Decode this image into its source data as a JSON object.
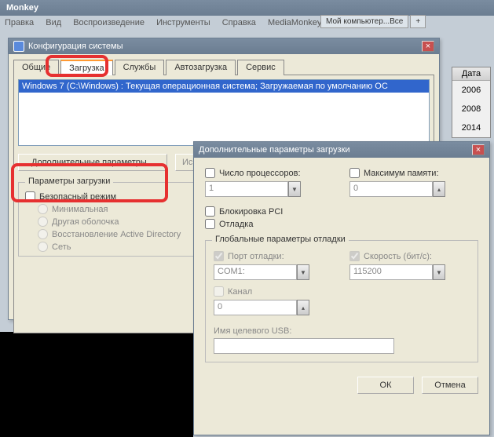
{
  "app": {
    "title": "Monkey",
    "menu": [
      "Правка",
      "Вид",
      "Воспроизведение",
      "Инструменты",
      "Справка",
      "MediaMonkey Gold"
    ],
    "tab_label": "Мой компьютер...Все",
    "plus": "+"
  },
  "side": {
    "header": "Дата",
    "items": [
      "2006",
      "2008",
      "2014"
    ]
  },
  "msconfig": {
    "title": "Конфигурация системы",
    "close": "×",
    "tabs": {
      "general": "Общие",
      "boot": "Загрузка",
      "services": "Службы",
      "startup": "Автозагрузка",
      "tools": "Сервис"
    },
    "os_line": "Windows 7 (C:\\Windows) : Текущая операционная система; Загружаемая по умолчанию ОС",
    "adv_btn": "Дополнительные параметры...",
    "use_btn": "Исполь",
    "boot_params_title": "Параметры загрузки",
    "safe_mode": "Безопасный режим",
    "minimal": "Минимальная",
    "altshell": "Другая оболочка",
    "adrepair": "Восстановление Active Directory",
    "network": "Сеть"
  },
  "adv": {
    "title": "Дополнительные параметры загрузки",
    "close": "×",
    "num_proc_label": "Число процессоров:",
    "num_proc_value": "1",
    "max_mem_label": "Максимум памяти:",
    "max_mem_value": "0",
    "pci_lock": "Блокировка PCI",
    "debug": "Отладка",
    "global_title": "Глобальные параметры отладки",
    "debug_port_label": "Порт отладки:",
    "debug_port_value": "COM1:",
    "baud_label": "Скорость (бит/с):",
    "baud_value": "115200",
    "channel_label": "Канал",
    "channel_value": "0",
    "usb_label": "Имя целевого USB:",
    "usb_value": "",
    "ok": "ОК",
    "cancel": "Отмена"
  }
}
